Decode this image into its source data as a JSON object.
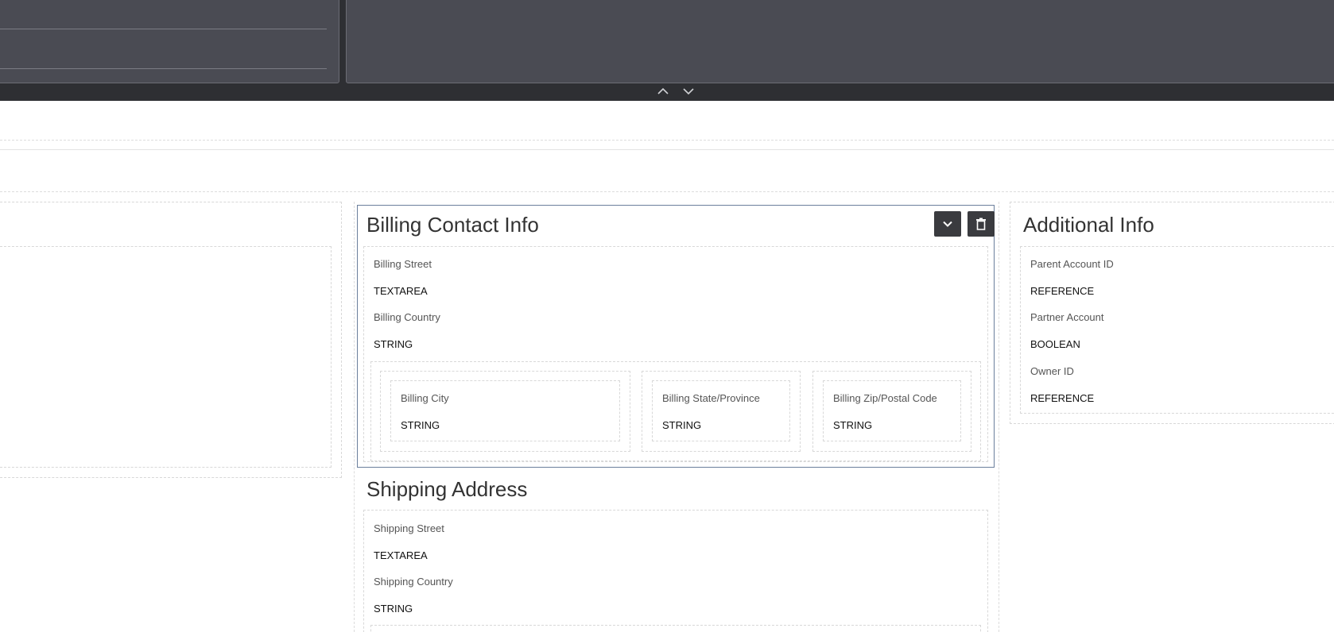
{
  "toolbar": {
    "collapse_up_icon": "chevron-up-icon",
    "expand_down_icon": "chevron-down-icon"
  },
  "billing": {
    "title": "Billing Contact Info",
    "actions": {
      "collapse_icon": "chevron-down-icon",
      "delete_icon": "trash-icon"
    },
    "fields": [
      {
        "label": "Billing Street",
        "type": "TEXTAREA"
      },
      {
        "label": "Billing Country",
        "type": "STRING"
      }
    ],
    "row": [
      {
        "label": "Billing City",
        "type": "STRING"
      },
      {
        "label": "Billing State/Province",
        "type": "STRING"
      },
      {
        "label": "Billing Zip/Postal Code",
        "type": "STRING"
      }
    ]
  },
  "additional": {
    "title": "Additional Info",
    "fields": [
      {
        "label": "Parent Account ID",
        "type": "REFERENCE"
      },
      {
        "label": "Partner Account",
        "type": "BOOLEAN"
      },
      {
        "label": "Owner ID",
        "type": "REFERENCE"
      }
    ]
  },
  "shipping": {
    "title": "Shipping Address",
    "fields": [
      {
        "label": "Shipping Street",
        "type": "TEXTAREA"
      },
      {
        "label": "Shipping Country",
        "type": "STRING"
      }
    ]
  }
}
